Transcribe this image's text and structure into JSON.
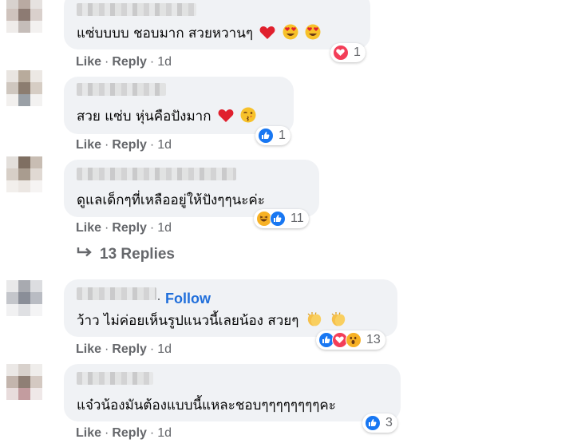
{
  "colors": {
    "bubble": "#f0f2f5",
    "link_blue": "#216fdb",
    "meta_gray": "#65676b",
    "like_blue": "#1877f2",
    "love_red": "#f33e58",
    "haha_yellow": "#f7b125"
  },
  "comments": [
    {
      "text": "แซ่บบบบ ชอบมาก สวยหวานๆ",
      "inline_emojis": [
        "red-heart",
        "heart-eyes",
        "heart-eyes"
      ],
      "reactions": {
        "icons": [
          "love-icon"
        ],
        "count": "1"
      },
      "actions": {
        "like": "Like",
        "reply": "Reply",
        "time": "1d"
      }
    },
    {
      "text": "สวย แซ่บ หุ่นคือปังมาก",
      "inline_emojis": [
        "red-heart",
        "kissing-face"
      ],
      "reactions": {
        "icons": [
          "like-icon"
        ],
        "count": "1"
      },
      "actions": {
        "like": "Like",
        "reply": "Reply",
        "time": "1d"
      }
    },
    {
      "text": "ดูแลเด็กๆที่เหลืออยู่ให้ปังๆๆนะค่ะ",
      "inline_emojis": [],
      "reactions": {
        "icons": [
          "haha-icon",
          "like-icon"
        ],
        "count": "11"
      },
      "actions": {
        "like": "Like",
        "reply": "Reply",
        "time": "1d"
      },
      "replies_label": "13 Replies"
    },
    {
      "follow": "Follow",
      "text": "ว้าว ไม่ค่อยเห็นรูปแนวนี้เลยน้อง สวยๆ",
      "inline_emojis": [
        "clapping-hands",
        "clapping-hands"
      ],
      "reactions": {
        "icons": [
          "like-icon",
          "love-icon",
          "wow-icon"
        ],
        "count": "13"
      },
      "actions": {
        "like": "Like",
        "reply": "Reply",
        "time": "1d"
      }
    },
    {
      "text": "แจ๋วน้องมันต้องแบบนี้แหละชอบๆๆๆๆๆๆๆๆคะ",
      "inline_emojis": [],
      "reactions": {
        "icons": [
          "like-icon"
        ],
        "count": "3"
      },
      "actions": {
        "like": "Like",
        "reply": "Reply",
        "time": "1d"
      }
    }
  ]
}
